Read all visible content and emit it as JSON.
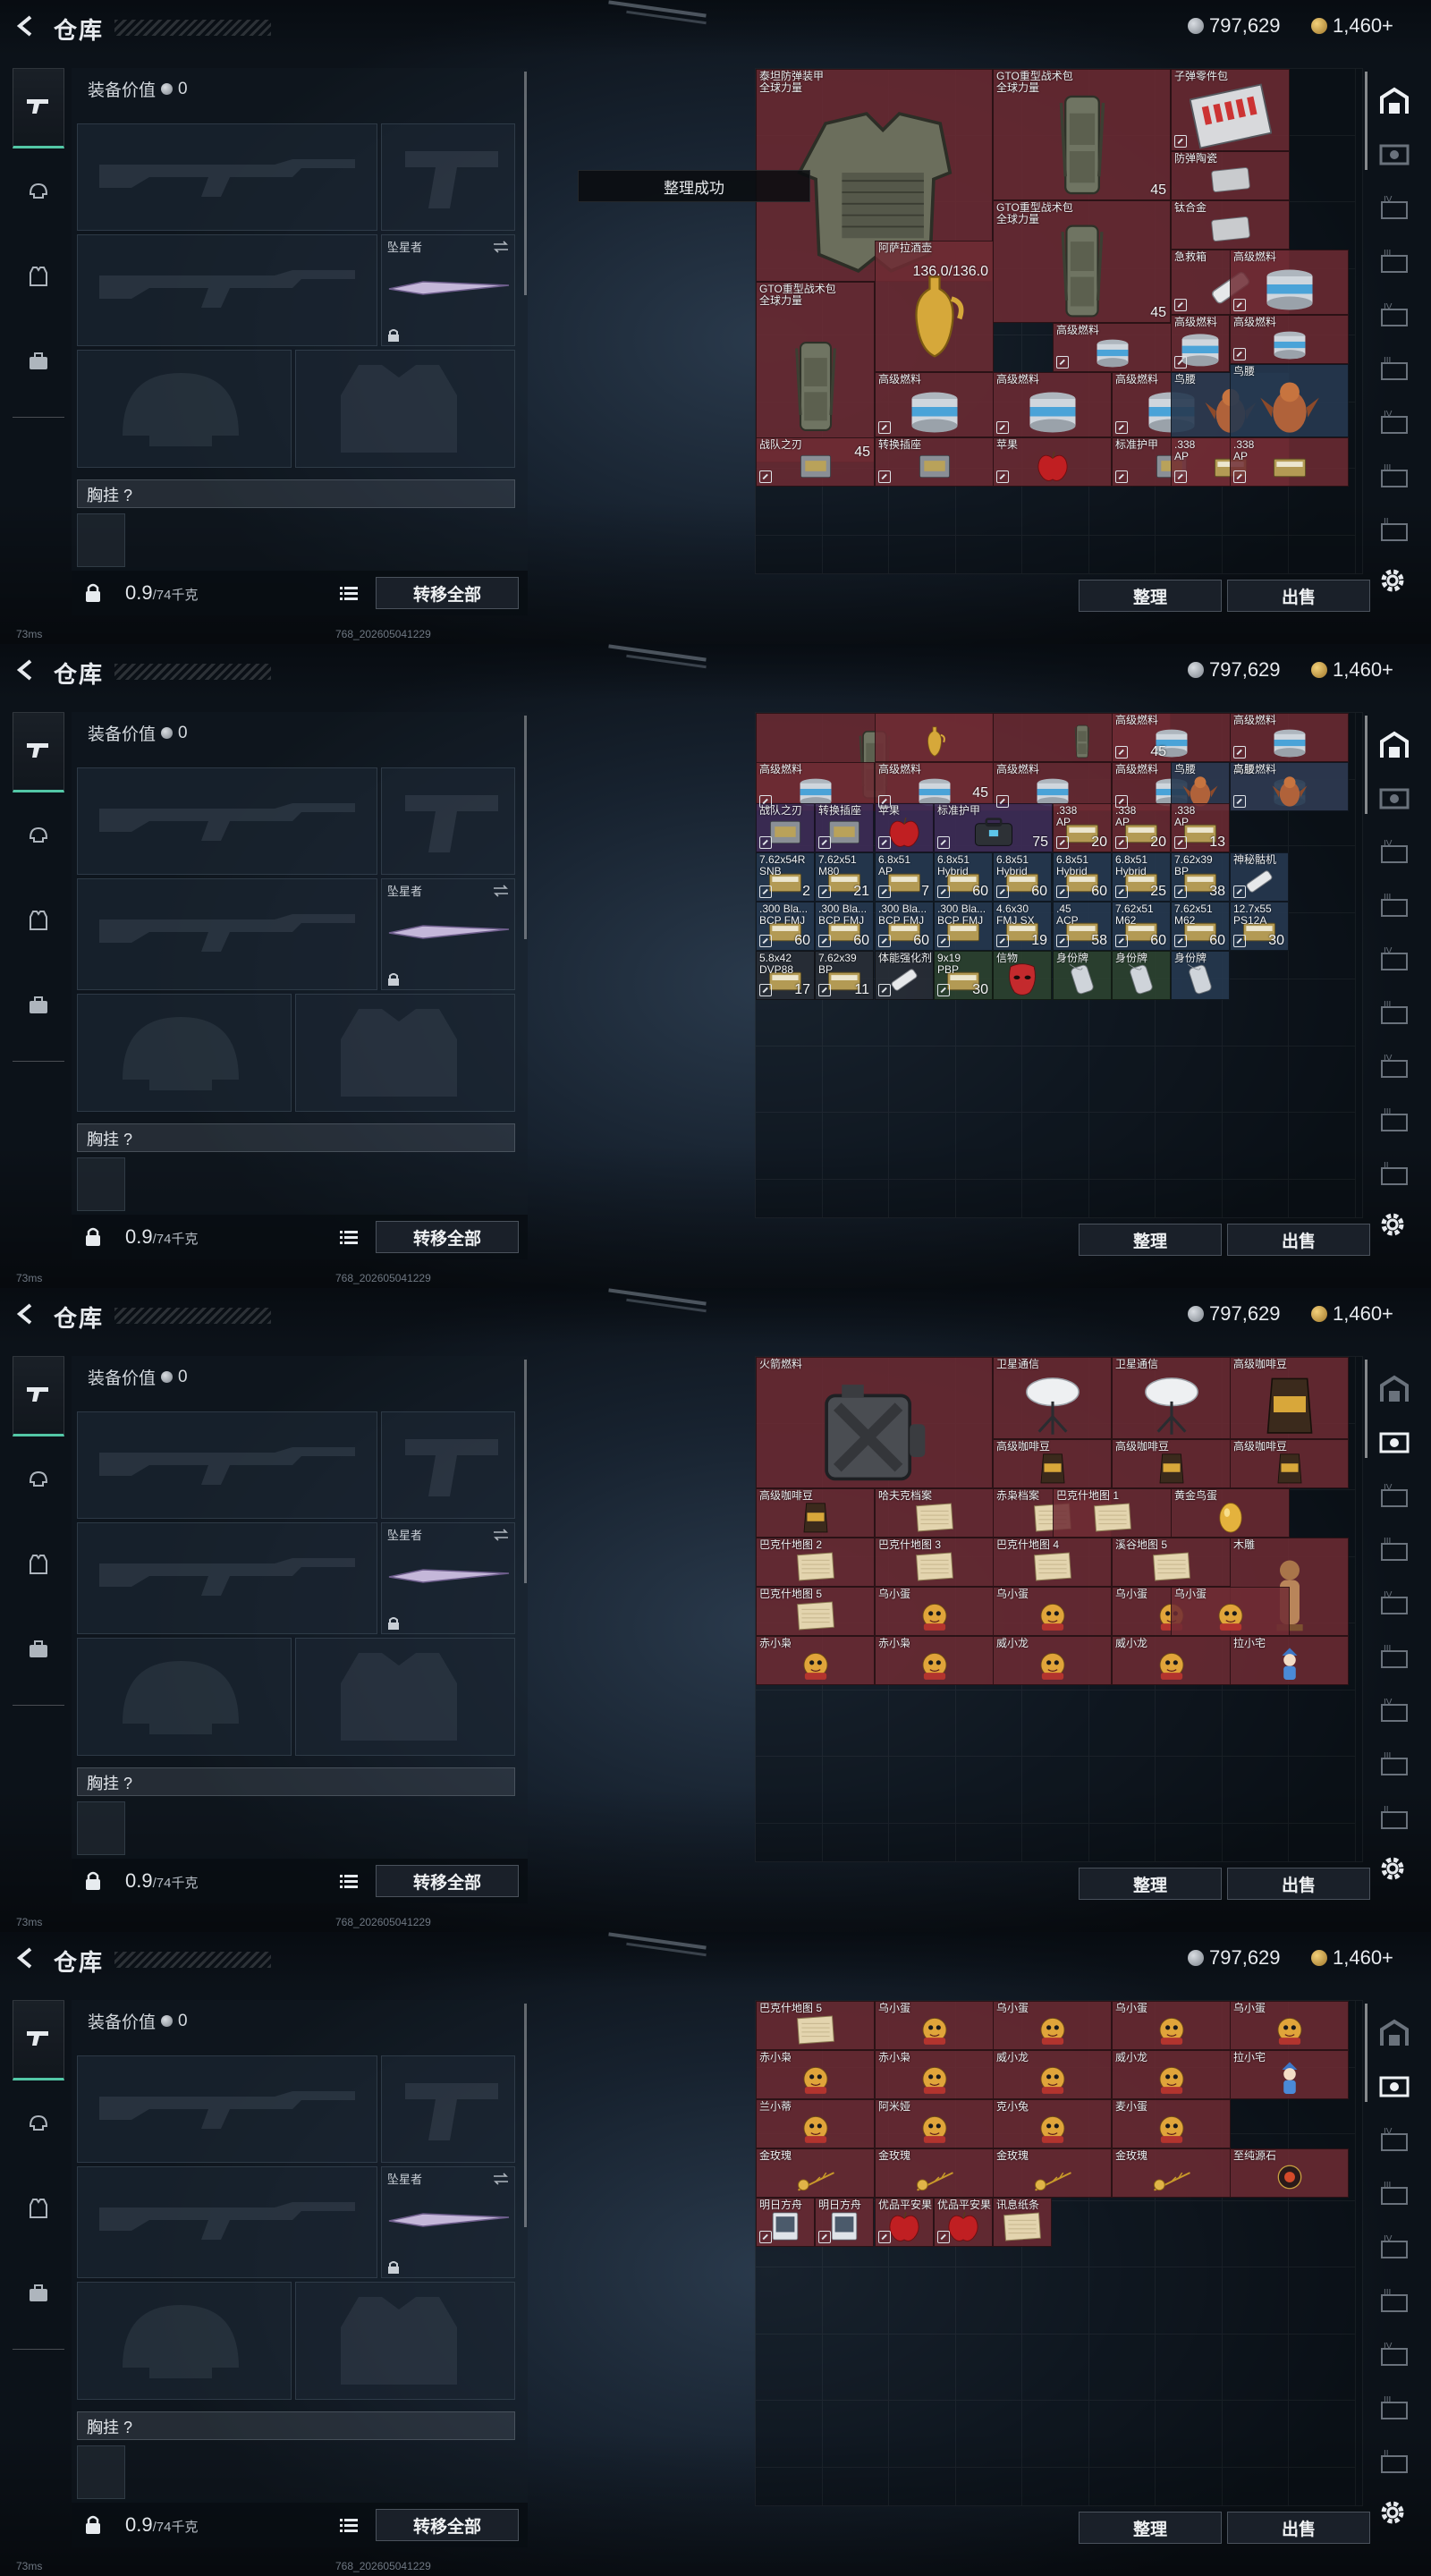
{
  "title": "仓库",
  "currency": {
    "silver": "797,629",
    "gold": "1,460+"
  },
  "equipment": {
    "value_label": "装备价值",
    "value": "0",
    "melee_name": "坠星者",
    "chest_label": "胸挂",
    "chest_help": "?",
    "weight": "0.9",
    "weight_cap": "/74千克",
    "transfer_all": "转移全部"
  },
  "toolbar": {
    "sort": "整理",
    "sell": "出售"
  },
  "toast": "整理成功",
  "status": {
    "ping": "73ms",
    "build": "768_202605041229"
  },
  "icons": {
    "left_nav": [
      "gun-icon",
      "helmet-icon",
      "vest-icon",
      "case-icon"
    ],
    "right_nav": [
      "warehouse-icon",
      "ticket-icon",
      "box-iv-icon",
      "box-iii-icon",
      "box-iv-icon",
      "box-iii-icon",
      "box-iv-icon",
      "box-iii-icon",
      "box-ii-icon"
    ]
  },
  "panels": [
    {
      "items": [
        {
          "name": "泰坦防弹装甲\n全球力量",
          "count": "136.0/136.0",
          "color": "red",
          "art": "armor"
        },
        {
          "name": "GTO重型战术包\n全球力量",
          "count": "45",
          "color": "red",
          "art": "pack"
        },
        {
          "name": "子弹零件包",
          "count": "",
          "color": "red",
          "art": "kit"
        },
        {
          "name": "防弹陶瓷",
          "count": "",
          "color": "red",
          "art": "plate"
        },
        {
          "name": "钛合金",
          "count": "",
          "color": "red",
          "art": "plate"
        },
        {
          "name": "GTO重型战术包\n全球力量",
          "count": "45",
          "color": "red",
          "art": "pack"
        },
        {
          "name": "GTO重型战术包\n全球力量",
          "count": "45",
          "color": "red",
          "art": "pack"
        },
        {
          "name": "阿萨拉酒壶",
          "count": "",
          "color": "red",
          "art": "vase"
        },
        {
          "name": "急救箱",
          "count": "",
          "color": "red",
          "art": "tube"
        },
        {
          "name": "高级燃料",
          "count": "",
          "color": "red",
          "art": "can"
        },
        {
          "name": "高级燃料",
          "count": "",
          "color": "red",
          "art": "can"
        },
        {
          "name": "高级燃料",
          "count": "",
          "color": "red",
          "art": "can"
        },
        {
          "name": "高级燃料",
          "count": "",
          "color": "red",
          "art": "can"
        },
        {
          "name": "高级燃料",
          "count": "",
          "color": "red",
          "art": "can"
        },
        {
          "name": "高级燃料",
          "count": "",
          "color": "red",
          "art": "can"
        },
        {
          "name": "高级燃料",
          "count": "",
          "color": "red",
          "art": "can"
        },
        {
          "name": "鸟腰",
          "count": "",
          "color": "blue",
          "art": "bird"
        },
        {
          "name": "鸟腰",
          "count": "",
          "color": "blue",
          "art": "bird"
        },
        {
          "name": "战队之刃",
          "count": "",
          "color": "red",
          "art": "box"
        },
        {
          "name": "转换插座",
          "count": "",
          "color": "red",
          "art": "box"
        },
        {
          "name": "苹果",
          "count": "",
          "color": "red",
          "art": "apple"
        },
        {
          "name": "标准护甲",
          "count": "",
          "color": "red",
          "art": "box"
        },
        {
          "name": ".338\nAP",
          "count": "",
          "color": "red",
          "art": "ammo"
        },
        {
          "name": ".338\nAP",
          "count": "",
          "color": "red",
          "art": "ammo"
        }
      ]
    },
    {
      "items": [
        {
          "name": "",
          "count": "45",
          "color": "red",
          "art": "pack"
        },
        {
          "name": "",
          "count": "",
          "color": "red",
          "art": "vase"
        },
        {
          "name": "",
          "count": "45",
          "color": "red",
          "art": "pack"
        },
        {
          "name": "高级燃料",
          "count": "",
          "color": "red",
          "art": "can"
        },
        {
          "name": "高级燃料",
          "count": "",
          "color": "red",
          "art": "can"
        },
        {
          "name": "高级燃料",
          "count": "",
          "color": "red",
          "art": "can"
        },
        {
          "name": "高级燃料",
          "count": "",
          "color": "red",
          "art": "can"
        },
        {
          "name": "高级燃料",
          "count": "",
          "color": "red",
          "art": "can"
        },
        {
          "name": "高级燃料",
          "count": "",
          "color": "red",
          "art": "can"
        },
        {
          "name": "高级燃料",
          "count": "",
          "color": "red",
          "art": "can"
        },
        {
          "name": "鸟腰",
          "count": "",
          "color": "blue",
          "art": "bird"
        },
        {
          "name": "鸟腰",
          "count": "",
          "color": "blue",
          "art": "bird"
        },
        {
          "name": "战队之刃",
          "count": "",
          "color": "purple",
          "art": "box"
        },
        {
          "name": "转换插座",
          "count": "",
          "color": "purple",
          "art": "box"
        },
        {
          "name": "苹果",
          "count": "",
          "color": "purple",
          "art": "apple"
        },
        {
          "name": "标准护甲",
          "count": "75",
          "color": "purple",
          "art": "bag"
        },
        {
          "name": ".338\nAP",
          "count": "20",
          "color": "red",
          "art": "ammo"
        },
        {
          "name": ".338\nAP",
          "count": "20",
          "color": "red",
          "art": "ammo"
        },
        {
          "name": ".338\nAP",
          "count": "13",
          "color": "red",
          "art": "ammo"
        },
        {
          "name": "7.62x54R\nSNB",
          "count": "2",
          "color": "blue",
          "art": "ammo"
        },
        {
          "name": "7.62x51\nM80",
          "count": "21",
          "color": "blue",
          "art": "ammo"
        },
        {
          "name": "6.8x51\nAP",
          "count": "7",
          "color": "blue",
          "art": "ammo"
        },
        {
          "name": "6.8x51\nHybrid",
          "count": "60",
          "color": "blue",
          "art": "ammo"
        },
        {
          "name": "6.8x51\nHybrid",
          "count": "60",
          "color": "blue",
          "art": "ammo"
        },
        {
          "name": "6.8x51\nHybrid",
          "count": "60",
          "color": "blue",
          "art": "ammo"
        },
        {
          "name": "6.8x51\nHybrid",
          "count": "25",
          "color": "blue",
          "art": "ammo"
        },
        {
          "name": "7.62x39\nBP",
          "count": "38",
          "color": "blue",
          "art": "ammo"
        },
        {
          "name": "神秘骷机",
          "count": "",
          "color": "blue",
          "art": "tube"
        },
        {
          "name": ".300 Bla...\nBCP FMJ",
          "count": "60",
          "color": "blue",
          "art": "ammo"
        },
        {
          "name": ".300 Bla...\nBCP FMJ",
          "count": "60",
          "color": "blue",
          "art": "ammo"
        },
        {
          "name": ".300 Bla...\nBCP FMJ",
          "count": "60",
          "color": "blue",
          "art": "ammo"
        },
        {
          "name": ".300 Bla...\nBCP FMJ",
          "count": "",
          "color": "blue",
          "art": "ammo"
        },
        {
          "name": "4.6x30\nFMJ SX",
          "count": "19",
          "color": "blue",
          "art": "ammo"
        },
        {
          "name": ".45\nACP",
          "count": "58",
          "color": "blue",
          "art": "ammo"
        },
        {
          "name": "7.62x51\nM62",
          "count": "60",
          "color": "blue",
          "art": "ammo"
        },
        {
          "name": "7.62x51\nM62",
          "count": "60",
          "color": "blue",
          "art": "ammo"
        },
        {
          "name": "12.7x55\nPS12A",
          "count": "30",
          "color": "blue",
          "art": "ammo"
        },
        {
          "name": "5.8x42\nDVP88",
          "count": "17",
          "color": "gray",
          "art": "ammo"
        },
        {
          "name": "7.62x39\nBP",
          "count": "11",
          "color": "gray",
          "art": "ammo"
        },
        {
          "name": "体能强化剂",
          "count": "",
          "color": "gray",
          "art": "tube"
        },
        {
          "name": "9x19\nPBP",
          "count": "30",
          "color": "green",
          "art": "ammo"
        },
        {
          "name": "信物",
          "count": "",
          "color": "green",
          "art": "mask"
        },
        {
          "name": "身份牌",
          "count": "",
          "color": "green",
          "art": "tag"
        },
        {
          "name": "身份牌",
          "count": "",
          "color": "green",
          "art": "tag"
        },
        {
          "name": "身份牌",
          "count": "",
          "color": "blue",
          "art": "tag"
        }
      ]
    },
    {
      "items": [
        {
          "name": "火箭燃料",
          "count": "",
          "color": "red",
          "art": "jerry"
        },
        {
          "name": "卫星通信",
          "count": "",
          "color": "red",
          "art": "dish"
        },
        {
          "name": "卫星通信",
          "count": "",
          "color": "red",
          "art": "dish"
        },
        {
          "name": "高级咖啡豆",
          "count": "",
          "color": "red",
          "art": "coffee"
        },
        {
          "name": "高级咖啡豆",
          "count": "",
          "color": "red",
          "art": "coffee"
        },
        {
          "name": "高级咖啡豆",
          "count": "",
          "color": "red",
          "art": "coffee"
        },
        {
          "name": "高级咖啡豆",
          "count": "",
          "color": "red",
          "art": "coffee"
        },
        {
          "name": "高级咖啡豆",
          "count": "",
          "color": "red",
          "art": "coffee"
        },
        {
          "name": "哈夫克档案",
          "count": "",
          "color": "red",
          "art": "paper"
        },
        {
          "name": "赤枭档案",
          "count": "",
          "color": "red",
          "art": "paper"
        },
        {
          "name": "巴克什地图 1",
          "count": "",
          "color": "red",
          "art": "paper"
        },
        {
          "name": "黄金鸟蛋",
          "count": "",
          "color": "red",
          "art": "egg"
        },
        {
          "name": "巴克什地图 2",
          "count": "",
          "color": "red",
          "art": "paper"
        },
        {
          "name": "巴克什地图 3",
          "count": "",
          "color": "red",
          "art": "paper"
        },
        {
          "name": "巴克什地图 4",
          "count": "",
          "color": "red",
          "art": "paper"
        },
        {
          "name": "溪谷地图 5",
          "count": "",
          "color": "red",
          "art": "paper"
        },
        {
          "name": "木雕",
          "count": "",
          "color": "red",
          "art": "statue"
        },
        {
          "name": "巴克什地图 5",
          "count": "",
          "color": "red",
          "art": "paper"
        },
        {
          "name": "乌小蛋",
          "count": "",
          "color": "red",
          "art": "toy"
        },
        {
          "name": "乌小蛋",
          "count": "",
          "color": "red",
          "art": "toy"
        },
        {
          "name": "乌小蛋",
          "count": "",
          "color": "red",
          "art": "toy"
        },
        {
          "name": "乌小蛋",
          "count": "",
          "color": "red",
          "art": "toy"
        },
        {
          "name": "赤小枭",
          "count": "",
          "color": "red",
          "art": "toy"
        },
        {
          "name": "赤小枭",
          "count": "",
          "color": "red",
          "art": "toy"
        },
        {
          "name": "威小龙",
          "count": "",
          "color": "red",
          "art": "toy"
        },
        {
          "name": "威小龙",
          "count": "",
          "color": "red",
          "art": "toy"
        },
        {
          "name": "拉小宅",
          "count": "",
          "color": "red",
          "art": "doll"
        }
      ]
    },
    {
      "items": [
        {
          "name": "巴克什地图 5",
          "count": "",
          "color": "red",
          "art": "paper"
        },
        {
          "name": "乌小蛋",
          "count": "",
          "color": "red",
          "art": "toy"
        },
        {
          "name": "乌小蛋",
          "count": "",
          "color": "red",
          "art": "toy"
        },
        {
          "name": "乌小蛋",
          "count": "",
          "color": "red",
          "art": "toy"
        },
        {
          "name": "乌小蛋",
          "count": "",
          "color": "red",
          "art": "toy"
        },
        {
          "name": "赤小枭",
          "count": "",
          "color": "red",
          "art": "toy"
        },
        {
          "name": "赤小枭",
          "count": "",
          "color": "red",
          "art": "toy"
        },
        {
          "name": "威小龙",
          "count": "",
          "color": "red",
          "art": "toy"
        },
        {
          "name": "威小龙",
          "count": "",
          "color": "red",
          "art": "toy"
        },
        {
          "name": "拉小宅",
          "count": "",
          "color": "red",
          "art": "doll"
        },
        {
          "name": "兰小蒂",
          "count": "",
          "color": "red",
          "art": "toy"
        },
        {
          "name": "阿米娅",
          "count": "",
          "color": "red",
          "art": "toy"
        },
        {
          "name": "克小兔",
          "count": "",
          "color": "red",
          "art": "toy"
        },
        {
          "name": "麦小蛋",
          "count": "",
          "color": "red",
          "art": "toy"
        },
        {
          "name": "金玫瑰",
          "count": "",
          "color": "red",
          "art": "rose"
        },
        {
          "name": "金玫瑰",
          "count": "",
          "color": "red",
          "art": "rose"
        },
        {
          "name": "金玫瑰",
          "count": "",
          "color": "red",
          "art": "rose"
        },
        {
          "name": "金玫瑰",
          "count": "",
          "color": "red",
          "art": "rose"
        },
        {
          "name": "至纯源石",
          "count": "",
          "color": "red",
          "art": "orb"
        },
        {
          "name": "明日方舟",
          "count": "",
          "color": "red",
          "art": "card"
        },
        {
          "name": "明日方舟",
          "count": "",
          "color": "red",
          "art": "card"
        },
        {
          "name": "优品平安果",
          "count": "",
          "color": "red",
          "art": "apple"
        },
        {
          "name": "优品平安果",
          "count": "",
          "color": "red",
          "art": "apple"
        },
        {
          "name": "讯息纸条",
          "count": "",
          "color": "red",
          "art": "paper"
        }
      ]
    }
  ]
}
